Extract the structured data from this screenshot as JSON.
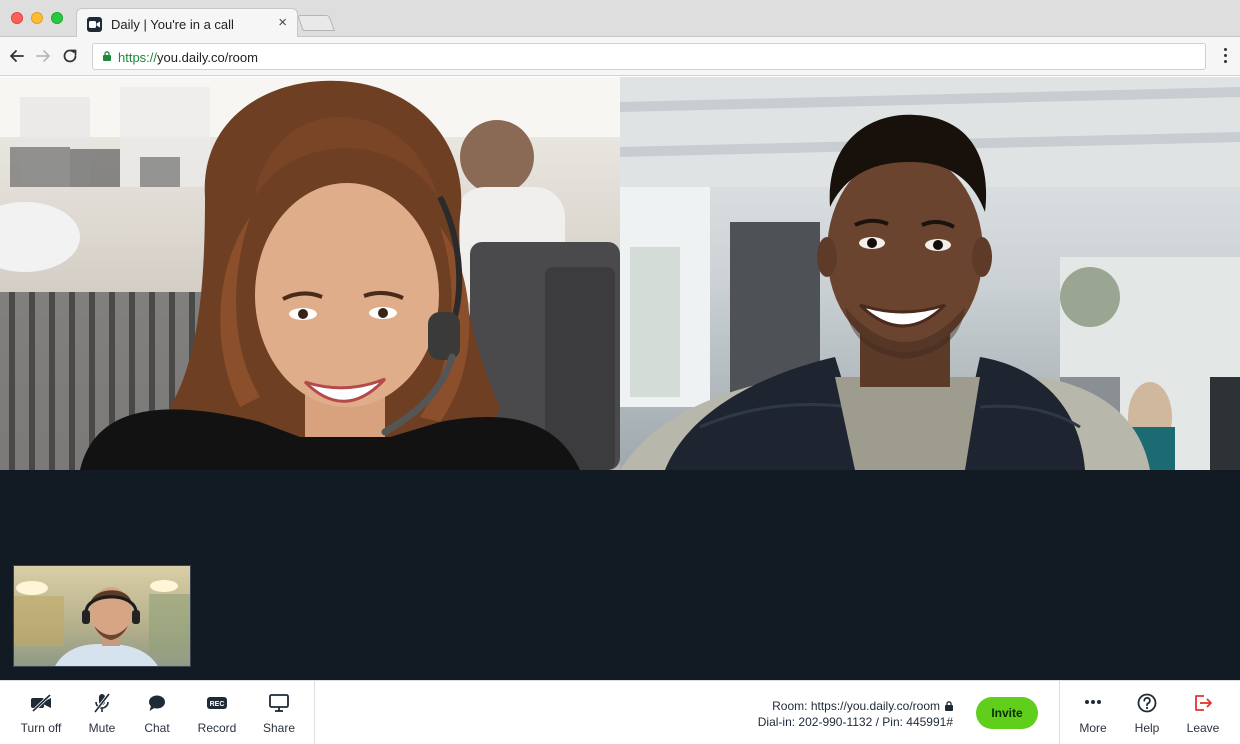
{
  "window": {
    "tab_title": "Daily | You're in a call",
    "tab_close": "×"
  },
  "address_bar": {
    "url_scheme": "https://",
    "url_rest": "you.daily.co/room"
  },
  "call": {
    "participants": [
      {
        "id": "participant-1"
      },
      {
        "id": "participant-2"
      }
    ],
    "self_view": {
      "id": "local-participant"
    }
  },
  "controls": {
    "left": [
      {
        "key": "turn-off",
        "label": "Turn off",
        "icon": "camera-off-icon"
      },
      {
        "key": "mute",
        "label": "Mute",
        "icon": "mic-off-icon"
      },
      {
        "key": "chat",
        "label": "Chat",
        "icon": "chat-bubble-icon"
      },
      {
        "key": "record",
        "label": "Record",
        "icon": "rec-icon",
        "icon_text": "REC"
      },
      {
        "key": "share",
        "label": "Share",
        "icon": "monitor-icon"
      }
    ],
    "room": {
      "room_line": "Room: https://you.daily.co/room",
      "dialin_line": "Dial-in: 202-990-1132 / Pin: 445991#"
    },
    "invite_label": "Invite",
    "right": [
      {
        "key": "more",
        "label": "More",
        "icon": "ellipsis-icon"
      },
      {
        "key": "help",
        "label": "Help",
        "icon": "question-circle-icon"
      },
      {
        "key": "leave",
        "label": "Leave",
        "icon": "leave-door-icon"
      }
    ]
  },
  "colors": {
    "call_background": "#121a24",
    "invite_green": "#5fcf1c",
    "leave_red": "#e5322d",
    "url_scheme_green": "#1c8a3a"
  }
}
